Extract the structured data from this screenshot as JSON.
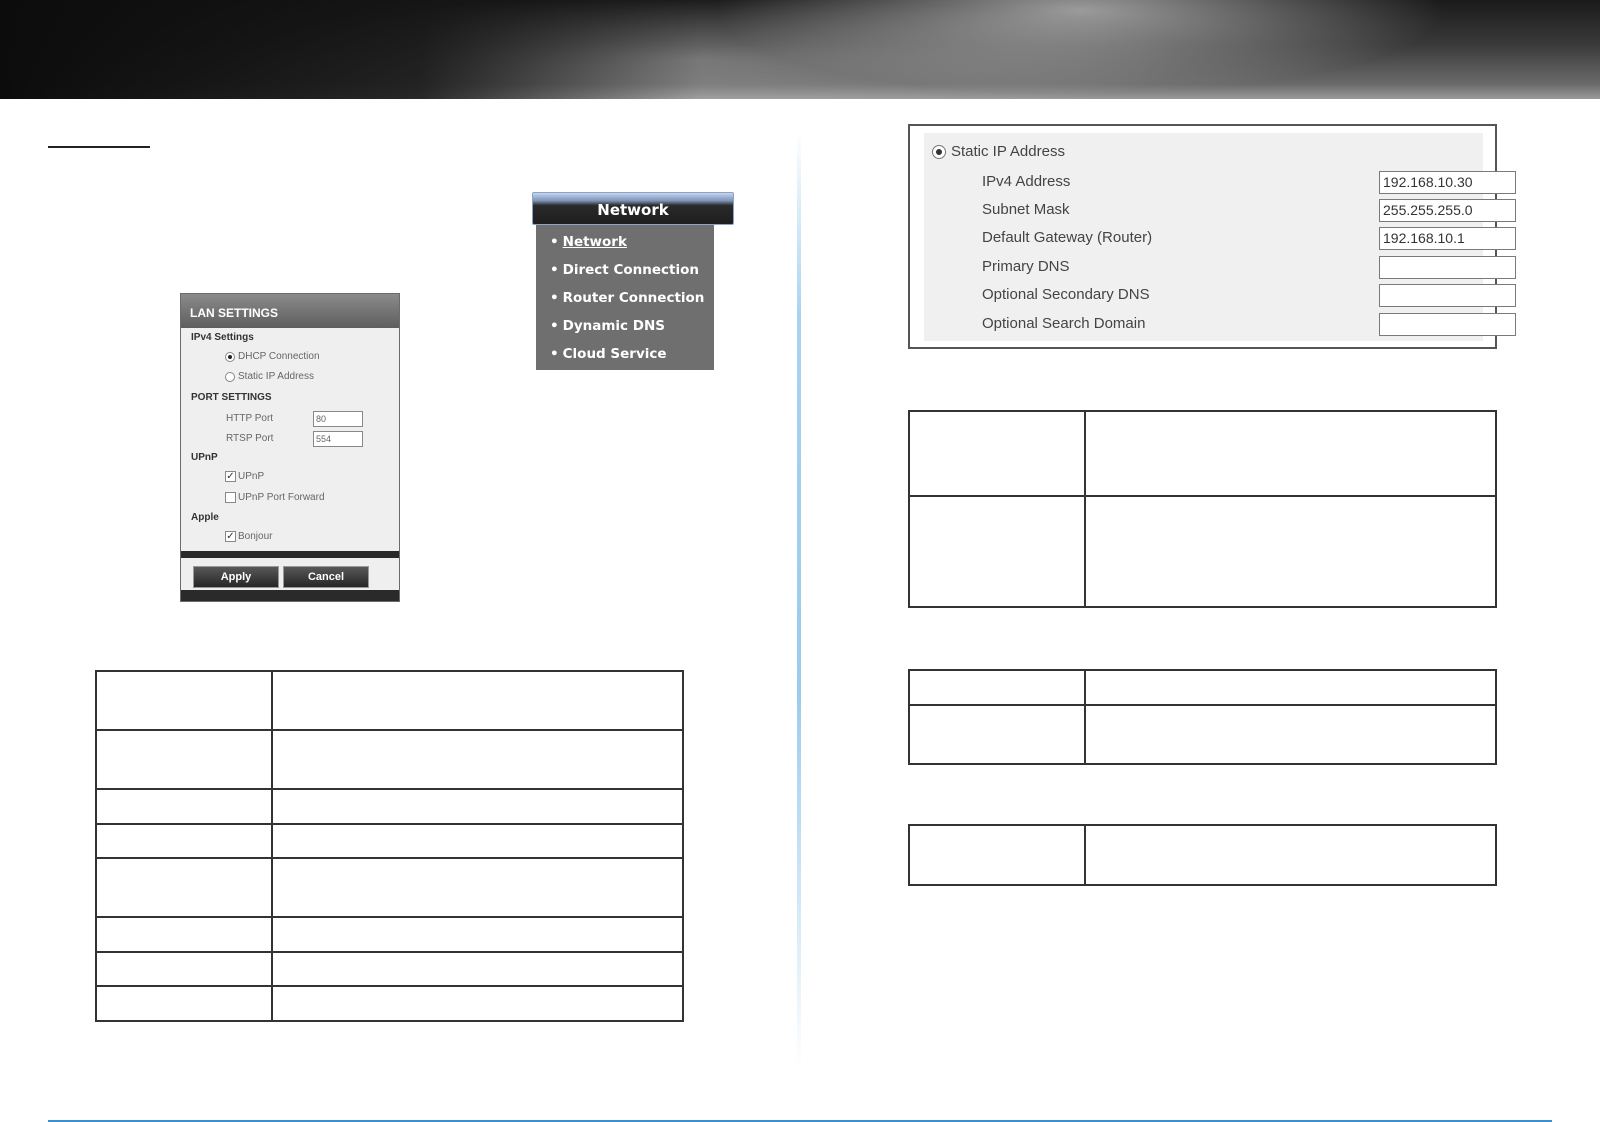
{
  "network_menu": {
    "title": "Network",
    "items": [
      {
        "label": "Network",
        "active": true
      },
      {
        "label": "Direct Connection",
        "active": false
      },
      {
        "label": "Router Connection",
        "active": false
      },
      {
        "label": "Dynamic DNS",
        "active": false
      },
      {
        "label": "Cloud Service",
        "active": false
      }
    ],
    "bullet": "•"
  },
  "lan_settings": {
    "title": "LAN SETTINGS",
    "ipv4_heading": "IPv4 Settings",
    "dhcp_label": "DHCP Connection",
    "static_label": "Static IP Address",
    "port_heading": "PORT SETTINGS",
    "http_label": "HTTP Port",
    "http_value": "80",
    "rtsp_label": "RTSP Port",
    "rtsp_value": "554",
    "upnp_heading": "UPnP",
    "upnp_label": "UPnP",
    "upnp_forward_label": "UPnP Port Forward",
    "apple_heading": "Apple",
    "bonjour_label": "Bonjour",
    "apply_label": "Apply",
    "cancel_label": "Cancel",
    "dhcp_selected": true,
    "upnp_checked": true,
    "upnp_forward_checked": false,
    "bonjour_checked": true
  },
  "static_ip": {
    "title": "Static IP Address",
    "fields": [
      {
        "label": "IPv4 Address",
        "value": "192.168.10.30"
      },
      {
        "label": "Subnet Mask",
        "value": "255.255.255.0"
      },
      {
        "label": "Default Gateway (Router)",
        "value": "192.168.10.1"
      },
      {
        "label": "Primary DNS",
        "value": ""
      },
      {
        "label": "Optional Secondary DNS",
        "value": ""
      },
      {
        "label": "Optional Search Domain",
        "value": ""
      }
    ]
  },
  "colors": {
    "footer_rule": "#3a8fd0",
    "divider": "#a8d2f0",
    "menu_bg": "#6f6f6f"
  }
}
